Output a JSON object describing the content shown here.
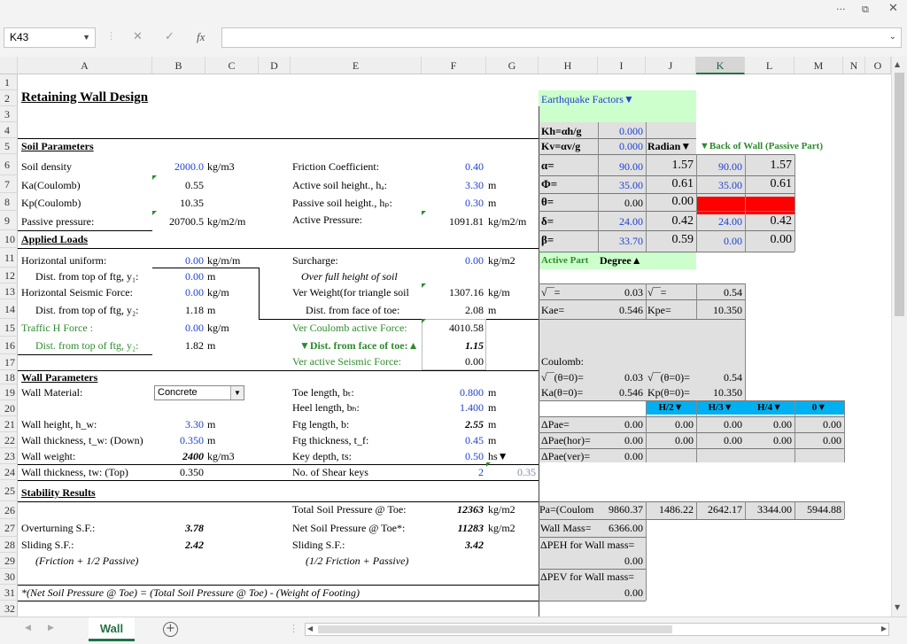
{
  "window": {
    "more_label": "···",
    "restore_label": "⧉",
    "close_label": "✕"
  },
  "formula_bar": {
    "name_box": "K43",
    "cancel_label": "✕",
    "enter_label": "✓",
    "fx_label": "fx",
    "formula": ""
  },
  "columns": [
    "A",
    "B",
    "C",
    "D",
    "E",
    "F",
    "G",
    "H",
    "I",
    "J",
    "K",
    "L",
    "M",
    "N",
    "O"
  ],
  "rows": [
    "1",
    "2",
    "3",
    "4",
    "5",
    "6",
    "7",
    "8",
    "9",
    "10",
    "11",
    "12",
    "13",
    "14",
    "15",
    "16",
    "17",
    "18",
    "19",
    "20",
    "21",
    "22",
    "23",
    "24",
    "25",
    "26",
    "27",
    "28",
    "29",
    "30",
    "31",
    "32"
  ],
  "selected_column": "K",
  "cells": {
    "title": "Retaining Wall Design",
    "soil_params": "Soil Parameters",
    "soil_density": "Soil density",
    "soil_density_val": "2000.0",
    "soil_density_unit": "kg/m3",
    "ka": "Ka(Coulomb)",
    "ka_val": "0.55",
    "kp": "Kp(Coulomb)",
    "kp_val": "10.35",
    "passive_pressure": "Passive pressure:",
    "passive_pressure_val": "20700.5",
    "passive_pressure_unit": "kg/m2/m",
    "friction_coef": "Friction Coefficient:",
    "friction_coef_val": "0.40",
    "active_height": "Active soil height., hₐ:",
    "active_height_val": "3.30",
    "active_height_unit": "m",
    "passive_height": "Passive soil height., hₚ:",
    "passive_height_val": "0.30",
    "passive_height_unit": "m",
    "active_pressure": "Active Pressure:",
    "active_pressure_val": "1091.81",
    "active_pressure_unit": "kg/m2/m",
    "applied_loads": "Applied Loads",
    "horiz_uniform": "Horizontal uniform:",
    "horiz_uniform_val": "0.00",
    "horiz_uniform_unit": "kg/m/m",
    "dist_top_y1": "Dist. from top of ftg, y₁:",
    "dist_top_y1_val": "0.00",
    "dist_top_y1_unit": "m",
    "horiz_seismic": "Horizontal Seismic Force:",
    "horiz_seismic_val": "0.00",
    "horiz_seismic_unit": "kg/m",
    "dist_top_y2": "Dist. from top of ftg, y₂:",
    "dist_top_y2_val": "1.18",
    "dist_top_y2_unit": "m",
    "traffic": "Traffic H  Force  :",
    "traffic_val": "0.00",
    "traffic_unit": "kg/m",
    "dist_top_y2b": "Dist. from top of ftg, y₂:",
    "dist_top_y2b_val": "1.82",
    "dist_top_y2b_unit": "m",
    "surcharge": "Surcharge:",
    "surcharge_val": "0.00",
    "surcharge_unit": "kg/m2",
    "over_full": "Over full height of soil",
    "ver_weight": "Ver Weight(for triangle soil",
    "ver_weight_val": "1307.16",
    "ver_weight_unit": "kg/m",
    "dist_face_toe": "Dist. from face of toe:",
    "dist_face_toe_val": "2.08",
    "dist_face_toe_unit": "m",
    "ver_coulomb": "Ver Coulomb active Force:",
    "ver_coulomb_val": "4010.58",
    "dist_face_toe2": "▼Dist. from face of toe:▲",
    "dist_face_toe2_val": "1.15",
    "ver_active_seismic": "Ver active Seismic Force:",
    "ver_active_seismic_val": "0.00",
    "wall_params": "Wall Parameters",
    "wall_material": "Wall Material:",
    "wall_material_val": "Concrete",
    "toe_length": "Toe length, bₜ:",
    "toe_length_val": "0.800",
    "toe_length_unit": "m",
    "heel_length": "Heel length, bₕ:",
    "heel_length_val": "1.400",
    "heel_length_unit": "m",
    "wall_height": "Wall height, h_w:",
    "wall_height_val": "3.30",
    "wall_height_unit": "m",
    "ftg_length": "Ftg length, b:",
    "ftg_length_val": "2.55",
    "ftg_length_unit": "m",
    "wall_thick_down": "Wall thickness, t_w: (Down)",
    "wall_thick_down_val": "0.350",
    "wall_thick_down_unit": "m",
    "ftg_thick": "Ftg thickness, t_f:",
    "ftg_thick_val": "0.45",
    "ftg_thick_unit": "m",
    "wall_weight": "Wall weight:",
    "wall_weight_val": "2400",
    "wall_weight_unit": "kg/m3",
    "key_depth": "Key depth, ts:",
    "key_depth_val": "0.50",
    "key_depth_unit": "hs▼",
    "wall_thick_top": "Wall thickness, tw: (Top)",
    "wall_thick_top_val": "0.350",
    "shear_keys": "No. of Shear keys",
    "shear_keys_val": "2",
    "shear_keys_extra": "0.35",
    "stability": "Stability Results",
    "total_soil": "Total Soil Pressure @ Toe:",
    "total_soil_val": "12363",
    "total_soil_unit": "kg/m2",
    "overturning": "Overturning S.F.:",
    "overturning_val": "3.78",
    "net_soil": "Net Soil Pressure @ Toe*:",
    "net_soil_val": "11283",
    "net_soil_unit": "kg/m2",
    "sliding": "Sliding S.F.:",
    "sliding_val": "2.42",
    "sliding2": "Sliding S.F.:",
    "sliding2_val": "3.42",
    "friction_passive": "(Friction + 1/2 Passive)",
    "friction_passive2": "(1/2 Friction + Passive)",
    "footnote": "*(Net Soil Pressure @ Toe) = (Total Soil Pressure @ Toe) - (Weight of Footing)",
    "eq_factors": "Earthquake Factors▼",
    "kh": "Kh=αh/g",
    "kh_val": "0.000",
    "kv": "Kv=αv/g",
    "kv_val": "0.000",
    "radian": "Radian▼",
    "back_wall": "▼Back of  Wall (Passive Part)",
    "alpha": "α=",
    "alpha_val": "90.00",
    "alpha_rad": "1.57",
    "alpha_k": "90.00",
    "alpha_l": "1.57",
    "phi": "Φ=",
    "phi_val": "35.00",
    "phi_rad": "0.61",
    "phi_k": "35.00",
    "phi_l": "0.61",
    "theta": "θ=",
    "theta_val": "0.00",
    "theta_rad": "0.00",
    "delta": "δ=",
    "delta_val": "24.00",
    "delta_rad": "0.42",
    "delta_k": "24.00",
    "delta_l": "0.42",
    "beta": "β=",
    "beta_val": "33.70",
    "beta_rad": "0.59",
    "beta_k": "0.00",
    "beta_l": "0.00",
    "active_part": "Active Part",
    "degree": "Degree▲",
    "sqrt1": "√‾‾=",
    "sqrt1_val": "0.03",
    "sqrt2": "√‾‾=",
    "sqrt2_val": "0.54",
    "kae": "Kae=",
    "kae_val": "0.546",
    "kpe": "Kpe=",
    "kpe_val": "10.350",
    "coulomb": "Coulomb:",
    "sqrt_t0": "√‾‾(θ=0)=",
    "sqrt_t0_val": "0.03",
    "sqrt_t0b": "√‾‾(θ=0)=",
    "sqrt_t0b_val": "0.54",
    "ka_t0": "Ka(θ=0)=",
    "ka_t0_val": "0.546",
    "kp_t0": "Kp(θ=0)=",
    "kp_t0_val": "10.350",
    "h2": "H/2▼",
    "h3": "H/3▼",
    "h4": "H/4▼",
    "zero": "0▼",
    "dpae": "ΔPae=",
    "dpae_i": "0.00",
    "dpae_j": "0.00",
    "dpae_k": "0.00",
    "dpae_l": "0.00",
    "dpae_m": "0.00",
    "dpae_hor": "ΔPae(hor)=",
    "dpae_hor_i": "0.00",
    "dpae_hor_j": "0.00",
    "dpae_hor_k": "0.00",
    "dpae_hor_l": "0.00",
    "dpae_hor_m": "0.00",
    "dpae_ver": "ΔPae(ver)=",
    "dpae_ver_i": "0.00",
    "pa_coulomb": "Pa=(Coulom",
    "pa_i": "9860.37",
    "pa_j": "1486.22",
    "pa_k": "2642.17",
    "pa_l": "3344.00",
    "pa_m": "5944.88",
    "wall_mass": "Wall Mass=",
    "wall_mass_val": "6366.00",
    "dpeh": "ΔPEH for Wall mass=",
    "dpeh_val": "0.00",
    "dpev": "ΔPEV for Wall mass=",
    "dpev_val": "0.00"
  },
  "sheet_tab": "Wall",
  "colors": {
    "green_bg": "#ccffcc",
    "grey_bg": "#e0e0e0",
    "red": "#ff0000",
    "cyan": "#00b0f0",
    "selected": "#217346"
  }
}
